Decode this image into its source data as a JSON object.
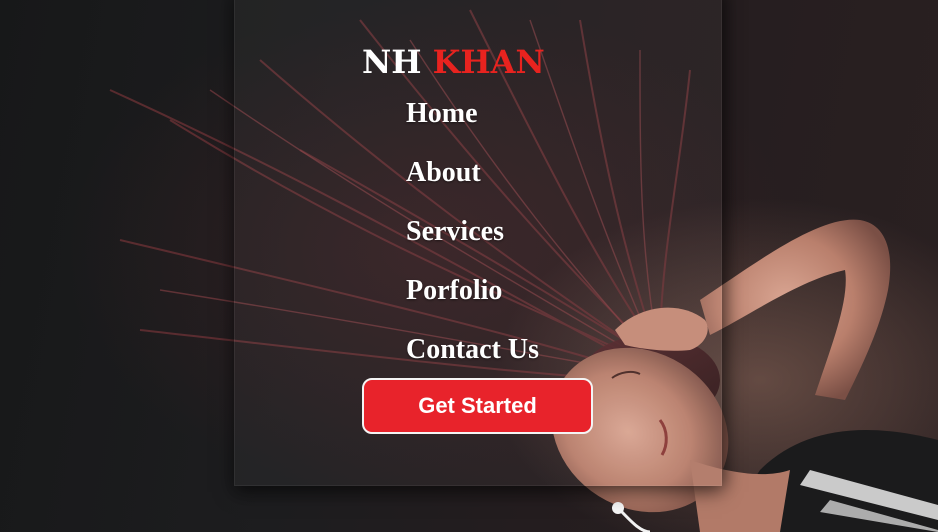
{
  "brand": {
    "name_primary": "NH",
    "name_accent": "KHAN",
    "accent_color": "#e8231f"
  },
  "nav": {
    "items": [
      {
        "label": "Home"
      },
      {
        "label": "About"
      },
      {
        "label": "Services"
      },
      {
        "label": "Porfolio"
      },
      {
        "label": "Contact Us"
      }
    ]
  },
  "cta": {
    "label": "Get Started",
    "background_color": "#e8232b"
  },
  "hero": {
    "image_subject": "woman-tossing-hair-with-headphones"
  }
}
